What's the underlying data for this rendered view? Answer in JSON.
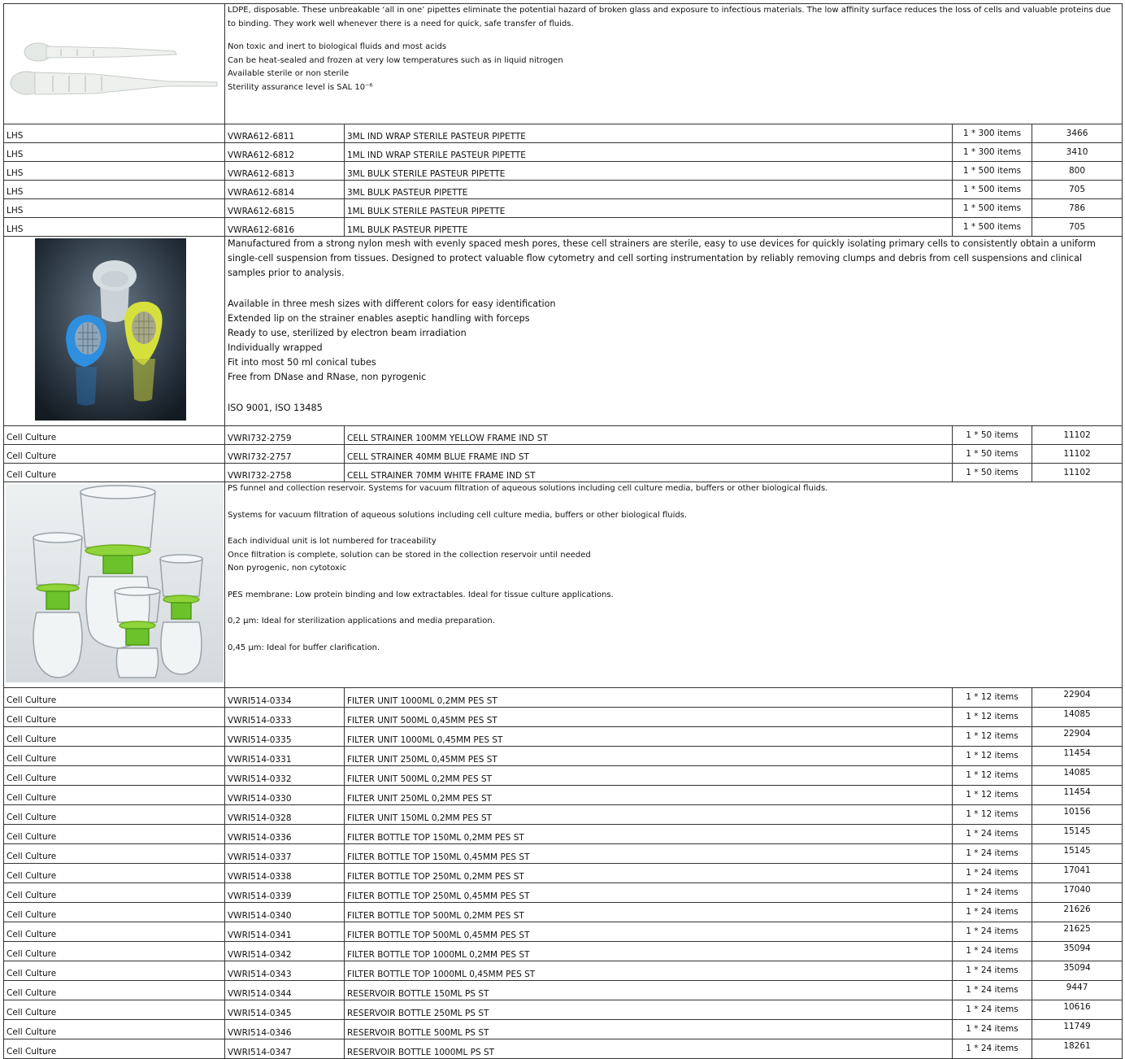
{
  "pipettes": {
    "desc_lines": [
      "LDPE, disposable. These unbreakable ‘all in one’ pipettes eliminate the potential hazard of broken glass and exposure to infectious materials. The low affinity surface reduces the loss of cells and valuable proteins due to binding. They work well whenever there is a need for quick, safe transfer of fluids.",
      "Non toxic and inert to biological fluids and most acids",
      "Can be heat-sealed and frozen at very low temperatures such as in liquid nitrogen",
      "Available sterile or non sterile",
      "Sterility assurance level is SAL 10⁻⁶"
    ],
    "rows": [
      {
        "cat": "LHS",
        "code": "VWRA612-6811",
        "name": "3ML IND WRAP STERILE PASTEUR PIPETTE",
        "pack": "1 * 300 items",
        "num": "3466"
      },
      {
        "cat": "LHS",
        "code": "VWRA612-6812",
        "name": "1ML IND WRAP STERILE PASTEUR PIPETTE",
        "pack": "1 * 300 items",
        "num": "3410"
      },
      {
        "cat": "LHS",
        "code": "VWRA612-6813",
        "name": "3ML BULK STERILE PASTEUR PIPETTE",
        "pack": "1 * 500 items",
        "num": "800"
      },
      {
        "cat": "LHS",
        "code": "VWRA612-6814",
        "name": "3ML BULK PASTEUR PIPETTE",
        "pack": "1 * 500 items",
        "num": "705"
      },
      {
        "cat": "LHS",
        "code": "VWRA612-6815",
        "name": "1ML BULK STERILE PASTEUR PIPETTE",
        "pack": "1 * 500 items",
        "num": "786"
      },
      {
        "cat": "LHS",
        "code": "VWRA612-6816",
        "name": "1ML BULK PASTEUR PIPETTE",
        "pack": "1 * 500 items",
        "num": "705"
      }
    ]
  },
  "strainers": {
    "intro": "Manufactured from a strong nylon mesh with evenly spaced mesh pores, these cell strainers are sterile, easy to use devices for quickly isolating primary cells to consistently obtain a uniform single-cell suspension from tissues. Designed to protect valuable flow cytometry and cell sorting instrumentation by reliably removing clumps and debris from cell suspensions and clinical samples prior to analysis.",
    "features": [
      "Available in three mesh sizes with different colors for easy identification",
      "Extended lip on the strainer enables aseptic handling with forceps",
      "Ready to use, sterilized by electron beam irradiation",
      "Individually wrapped",
      "Fit into most 50 ml conical tubes",
      "Free from DNase and RNase, non pyrogenic"
    ],
    "iso": "ISO 9001, ISO 13485",
    "rows": [
      {
        "cat": "Cell Culture",
        "code": "VWRI732-2759",
        "name": "CELL STRAINER 100MM YELLOW FRAME IND ST",
        "pack": "1 * 50 items",
        "num": "11102"
      },
      {
        "cat": "Cell Culture",
        "code": "VWRI732-2757",
        "name": "CELL STRAINER 40MM BLUE FRAME IND ST",
        "pack": "1 * 50 items",
        "num": "11102"
      },
      {
        "cat": "Cell Culture",
        "code": "VWRI732-2758",
        "name": "CELL STRAINER 70MM WHITE FRAME IND ST",
        "pack": "1 * 50 items",
        "num": "11102"
      }
    ]
  },
  "filters": {
    "p1": "PS funnel and collection reservoir. Systems for vacuum filtration of aqueous solutions including cell culture media, buffers or other biological fluids.",
    "p2": "Systems for vacuum filtration of aqueous solutions including cell culture media, buffers or other biological fluids.",
    "list": [
      "Each individual unit is lot numbered for traceability",
      "Once filtration is complete, solution can be stored in the collection reservoir until needed",
      "Non pyrogenic, non cytotoxic"
    ],
    "p3": "PES membrane: Low protein binding and low extractables. Ideal for tissue culture applications.",
    "p4": "0,2 µm: Ideal for sterilization applications and media preparation.",
    "p5": "0,45 µm: Ideal for buffer clarification.",
    "rows": [
      {
        "cat": "Cell Culture",
        "code": "VWRI514-0334",
        "name": "FILTER UNIT 1000ML 0,2MM PES ST",
        "pack": "1 * 12 items",
        "num": "22904"
      },
      {
        "cat": "Cell Culture",
        "code": "VWRI514-0333",
        "name": "FILTER UNIT 500ML 0,45MM PES ST",
        "pack": "1 * 12 items",
        "num": "14085"
      },
      {
        "cat": "Cell Culture",
        "code": "VWRI514-0335",
        "name": "FILTER UNIT 1000ML 0,45MM PES ST",
        "pack": "1 * 12 items",
        "num": "22904"
      },
      {
        "cat": "Cell Culture",
        "code": "VWRI514-0331",
        "name": "FILTER UNIT 250ML 0,45MM PES ST",
        "pack": "1 * 12 items",
        "num": "11454"
      },
      {
        "cat": "Cell Culture",
        "code": "VWRI514-0332",
        "name": "FILTER UNIT 500ML 0,2MM PES ST",
        "pack": "1 * 12 items",
        "num": "14085"
      },
      {
        "cat": "Cell Culture",
        "code": "VWRI514-0330",
        "name": "FILTER UNIT 250ML 0,2MM PES ST",
        "pack": "1 * 12 items",
        "num": "11454"
      },
      {
        "cat": "Cell Culture",
        "code": "VWRI514-0328",
        "name": "FILTER UNIT 150ML 0,2MM PES ST",
        "pack": "1 * 12 items",
        "num": "10156"
      },
      {
        "cat": "Cell Culture",
        "code": "VWRI514-0336",
        "name": "FILTER BOTTLE TOP 150ML 0,2MM PES ST",
        "pack": "1 * 24 items",
        "num": "15145"
      },
      {
        "cat": "Cell Culture",
        "code": "VWRI514-0337",
        "name": "FILTER BOTTLE TOP 150ML 0,45MM PES ST",
        "pack": "1 * 24 items",
        "num": "15145"
      },
      {
        "cat": "Cell Culture",
        "code": "VWRI514-0338",
        "name": "FILTER BOTTLE TOP 250ML 0,2MM PES ST",
        "pack": "1 * 24 items",
        "num": "17041"
      },
      {
        "cat": "Cell Culture",
        "code": "VWRI514-0339",
        "name": "FILTER BOTTLE TOP 250ML 0,45MM PES ST",
        "pack": "1 * 24 items",
        "num": "17040"
      },
      {
        "cat": "Cell Culture",
        "code": "VWRI514-0340",
        "name": "FILTER BOTTLE TOP 500ML 0,2MM PES ST",
        "pack": "1 * 24 items",
        "num": "21626"
      },
      {
        "cat": "Cell Culture",
        "code": "VWRI514-0341",
        "name": "FILTER BOTTLE TOP 500ML 0,45MM PES ST",
        "pack": "1 * 24 items",
        "num": "21625"
      },
      {
        "cat": "Cell Culture",
        "code": "VWRI514-0342",
        "name": "FILTER BOTTLE TOP 1000ML 0,2MM PES ST",
        "pack": "1 * 24 items",
        "num": "35094"
      },
      {
        "cat": "Cell Culture",
        "code": "VWRI514-0343",
        "name": "FILTER BOTTLE TOP 1000ML 0,45MM PES ST",
        "pack": "1 * 24 items",
        "num": "35094"
      },
      {
        "cat": "Cell Culture",
        "code": "VWRI514-0344",
        "name": "RESERVOIR BOTTLE 150ML PS ST",
        "pack": "1 * 24 items",
        "num": "9447"
      },
      {
        "cat": "Cell Culture",
        "code": "VWRI514-0345",
        "name": "RESERVOIR BOTTLE 250ML PS ST",
        "pack": "1 * 24 items",
        "num": "10616"
      },
      {
        "cat": "Cell Culture",
        "code": "VWRI514-0346",
        "name": "RESERVOIR BOTTLE 500ML PS ST",
        "pack": "1 * 24 items",
        "num": "11749"
      },
      {
        "cat": "Cell Culture",
        "code": "VWRI514-0347",
        "name": "RESERVOIR BOTTLE 1000ML PS ST",
        "pack": "1 * 24 items",
        "num": "18261"
      }
    ]
  }
}
